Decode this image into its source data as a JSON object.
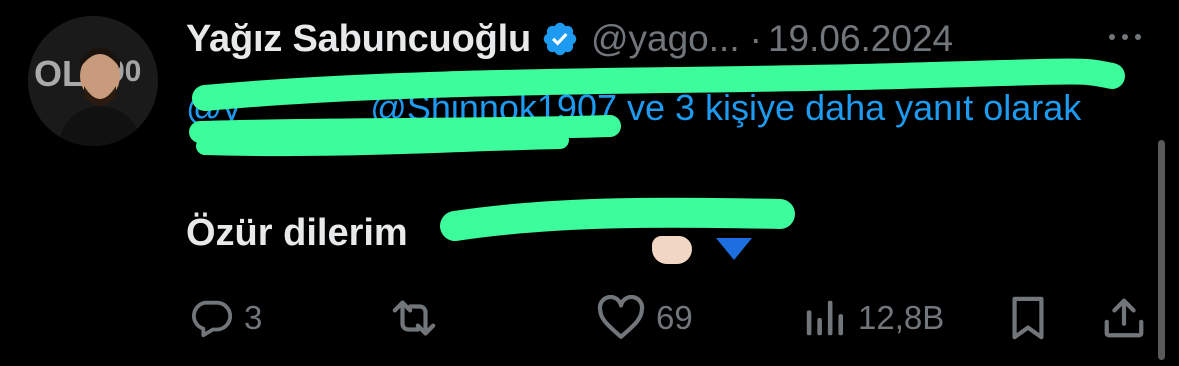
{
  "tweet": {
    "author": {
      "display_name": "Yağız Sabuncuoğlu",
      "handle": "@yago...",
      "avatar_icon": "profile-photo"
    },
    "separator": "·",
    "date": "19.06.2024",
    "reply_context": "@y                  @Shinnok1907 ve 3 kişiye daha yanıt olarak",
    "text": "Özür dilerim",
    "actions": {
      "replies": "3",
      "likes": "69",
      "views": "12,8B"
    }
  },
  "colors": {
    "background": "#000000",
    "primary_text": "#e7e9ea",
    "secondary_text": "#71767b",
    "link": "#1d9bf0",
    "verified": "#1d9bf0",
    "redaction": "#3dfc9c"
  }
}
